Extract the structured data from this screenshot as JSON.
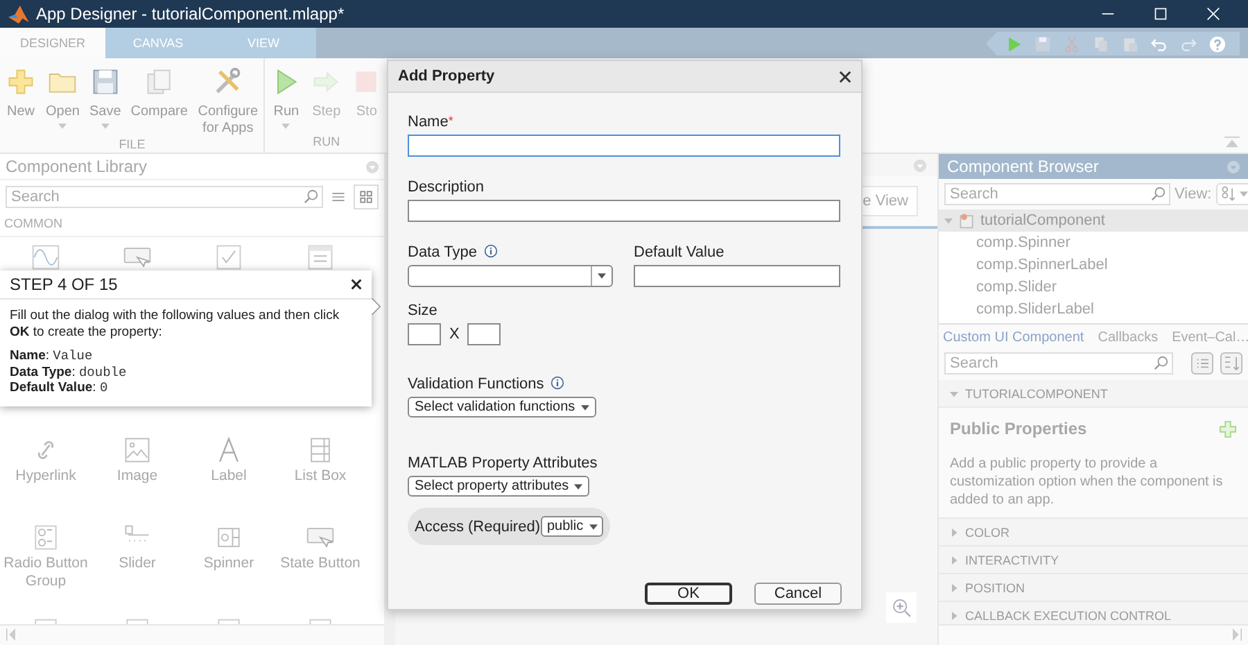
{
  "window": {
    "title": "App Designer - tutorialComponent.mlapp*"
  },
  "tabs": [
    {
      "label": "DESIGNER",
      "selected": true
    },
    {
      "label": "CANVAS",
      "selected": false
    },
    {
      "label": "VIEW",
      "selected": false
    }
  ],
  "quick_access": [
    {
      "kind": "run"
    },
    {
      "kind": "save"
    },
    {
      "kind": "cut"
    },
    {
      "kind": "copy"
    },
    {
      "kind": "paste"
    },
    {
      "kind": "undo"
    },
    {
      "kind": "redo"
    },
    {
      "kind": "help"
    }
  ],
  "toolstrip": [
    {
      "label": "FILE",
      "tools": [
        {
          "kind": "new",
          "label": "New",
          "dropdown": false,
          "disabled": false
        },
        {
          "kind": "open",
          "label": "Open",
          "dropdown": true,
          "disabled": false
        },
        {
          "kind": "save",
          "label": "Save",
          "dropdown": true,
          "disabled": false
        },
        {
          "kind": "compare",
          "label": "Compare",
          "dropdown": false,
          "disabled": false
        },
        {
          "kind": "configure",
          "label": "Configure for Apps",
          "dropdown": false,
          "disabled": false
        }
      ]
    },
    {
      "label": "RUN",
      "tools": [
        {
          "kind": "run",
          "label": "Run",
          "dropdown": true,
          "disabled": false
        },
        {
          "kind": "step",
          "label": "Step",
          "dropdown": false,
          "disabled": true
        },
        {
          "kind": "stop",
          "label": "Sto",
          "dropdown": false,
          "disabled": true
        }
      ]
    }
  ],
  "component_library": {
    "title": "Component Library",
    "search": {
      "placeholder": "Search"
    },
    "section": "COMMON",
    "items": [
      {
        "kind": "axes"
      },
      {
        "kind": "push"
      },
      {
        "kind": "check"
      },
      {
        "kind": "date"
      },
      {
        "kind": "hyperlink",
        "label": "Hyperlink"
      },
      {
        "kind": "image",
        "label": "Image"
      },
      {
        "kind": "label",
        "label": "Label"
      },
      {
        "kind": "listbox",
        "label": "List Box"
      },
      {
        "kind": "radio",
        "label": "Radio Button Group"
      },
      {
        "kind": "slider",
        "label": "Slider"
      },
      {
        "kind": "spinner",
        "label": "Spinner"
      },
      {
        "kind": "state",
        "label": "State Button"
      },
      {
        "kind": "blank"
      },
      {
        "kind": "blank"
      },
      {
        "kind": "blank"
      },
      {
        "kind": "blank"
      }
    ]
  },
  "canvas": {
    "view_button": "e View"
  },
  "component_browser": {
    "title": "Component Browser",
    "search": {
      "placeholder": "Search"
    },
    "view_label": "View:",
    "tree": [
      {
        "label": "tutorialComponent",
        "expanded": true,
        "selected": true,
        "children": [
          {
            "label": "comp.Spinner",
            "selected": false
          },
          {
            "label": "comp.SpinnerLabel",
            "selected": false
          },
          {
            "label": "comp.Slider",
            "selected": false
          },
          {
            "label": "comp.SliderLabel",
            "selected": false
          }
        ]
      }
    ],
    "inspector_tabs": [
      {
        "label": "Custom UI Component",
        "selected": true
      },
      {
        "label": "Callbacks",
        "selected": false
      },
      {
        "label": "Event–Cal…",
        "selected": false
      }
    ],
    "inspector_search": {
      "placeholder": "Search"
    },
    "sections": [
      {
        "label": "TUTORIALCOMPONENT",
        "expanded": true,
        "heading": "Public Properties",
        "description": "Add a public property to provide a customization option when the component is added to an app."
      },
      {
        "label": "COLOR",
        "expanded": false
      },
      {
        "label": "INTERACTIVITY",
        "expanded": false
      },
      {
        "label": "POSITION",
        "expanded": false
      },
      {
        "label": "CALLBACK EXECUTION CONTROL",
        "expanded": false
      }
    ]
  },
  "dialog": {
    "title": "Add Property",
    "name": {
      "label": "Name",
      "required_mark": "*",
      "focused": true
    },
    "description": {
      "label": "Description"
    },
    "data_type": {
      "label": "Data Type"
    },
    "default_value": {
      "label": "Default Value"
    },
    "size": {
      "label": "Size",
      "separator": "X"
    },
    "validation": {
      "label": "Validation Functions",
      "button": "Select validation functions"
    },
    "attributes": {
      "label": "MATLAB Property Attributes",
      "button": "Select property attributes"
    },
    "access": {
      "label": "Access (Required)",
      "value": "public"
    },
    "buttons": [
      {
        "label": "OK",
        "default": true
      },
      {
        "label": "Cancel",
        "default": false
      }
    ]
  },
  "tutorial": {
    "title": "STEP 4 OF 15",
    "text": "Fill out the dialog with the following values and then click **OK** to create the property:",
    "values": [
      {
        "label": "Name",
        "separator": ": ",
        "value": "Value"
      },
      {
        "label": "Data Type",
        "separator": ": ",
        "value": "double"
      },
      {
        "label": "Default Value",
        "separator": ": ",
        "value": "0"
      }
    ]
  }
}
